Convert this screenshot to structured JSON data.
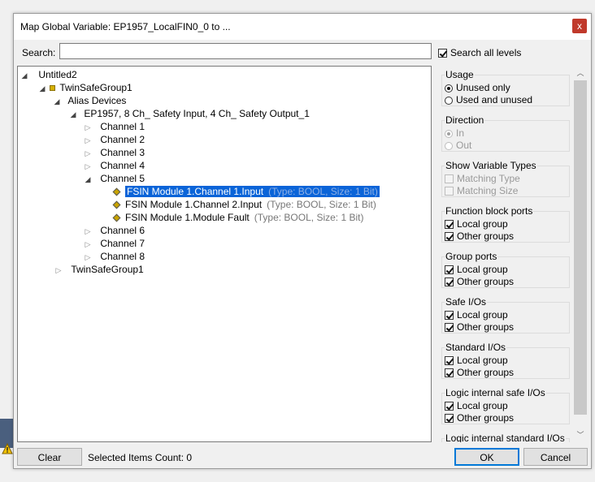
{
  "dialog": {
    "title": "Map Global Variable: EP1957_LocalFIN0_0 to ...",
    "close_symbol": "x"
  },
  "search": {
    "label": "Search:",
    "value": "",
    "search_all_label": "Search all levels",
    "search_all_checked": true
  },
  "tree": {
    "root": "Untitled2",
    "group1": "TwinSafeGroup1",
    "alias_devices": "Alias Devices",
    "device": "EP1957, 8 Ch_ Safety Input, 4 Ch_ Safety Output_1",
    "channels": [
      "Channel 1",
      "Channel 2",
      "Channel 3",
      "Channel 4",
      "Channel 5",
      "Channel 6",
      "Channel 7",
      "Channel 8"
    ],
    "channel5_items": [
      {
        "name": "FSIN Module 1.Channel 1.Input",
        "type": "(Type: BOOL, Size: 1 Bit)"
      },
      {
        "name": "FSIN Module 1.Channel 2.Input",
        "type": "(Type: BOOL, Size: 1 Bit)"
      },
      {
        "name": "FSIN Module 1.Module Fault",
        "type": "(Type: BOOL, Size: 1 Bit)"
      }
    ],
    "group2": "TwinSafeGroup1"
  },
  "filters": {
    "usage": {
      "title": "Usage",
      "unused_only": "Unused only",
      "used_and_unused": "Used and unused"
    },
    "direction": {
      "title": "Direction",
      "in": "In",
      "out": "Out"
    },
    "show_types": {
      "title": "Show Variable Types",
      "matching_type": "Matching Type",
      "matching_size": "Matching Size"
    },
    "function_block_ports": {
      "title": "Function block ports",
      "local": "Local group",
      "other": "Other groups"
    },
    "group_ports": {
      "title": "Group ports",
      "local": "Local group",
      "other": "Other groups"
    },
    "safe_ios": {
      "title": "Safe I/Os",
      "local": "Local group",
      "other": "Other groups"
    },
    "standard_ios": {
      "title": "Standard I/Os",
      "local": "Local group",
      "other": "Other groups"
    },
    "logic_internal_safe": {
      "title": "Logic internal safe I/Os",
      "local": "Local group",
      "other": "Other groups"
    },
    "logic_internal_standard": {
      "title": "Logic internal standard I/Os"
    }
  },
  "footer": {
    "clear_label": "Clear",
    "selected_count": "Selected Items Count: 0",
    "ok_label": "OK",
    "cancel_label": "Cancel"
  },
  "icons": {
    "expanded": "expanded-triangle-icon",
    "collapsed": "collapsed-triangle-icon",
    "group": "safety-group-icon",
    "variable": "variable-icon",
    "warning": "warning-icon"
  },
  "colors": {
    "selection": "#0a64d8",
    "close_button": "#c0392b",
    "default_button_border": "#0078d7"
  }
}
